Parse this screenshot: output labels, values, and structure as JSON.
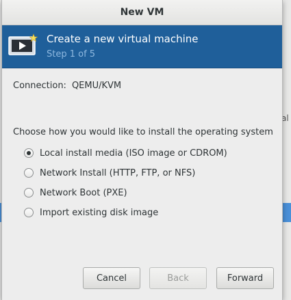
{
  "dialog": {
    "title": "New VM",
    "banner_title": "Create a new virtual machine",
    "banner_step": "Step 1 of 5",
    "connection_label": "Connection:",
    "connection_value": "QEMU/KVM",
    "install_prompt": "Choose how you would like to install the operating system",
    "options": [
      {
        "label": "Local install media (ISO image or CDROM)",
        "selected": true
      },
      {
        "label": "Network Install (HTTP, FTP, or NFS)",
        "selected": false
      },
      {
        "label": "Network Boot (PXE)",
        "selected": false
      },
      {
        "label": "Import existing disk image",
        "selected": false
      }
    ],
    "buttons": {
      "cancel": "Cancel",
      "back": "Back",
      "forward": "Forward"
    }
  },
  "background_window": {
    "edge_text": "al"
  },
  "colors": {
    "banner": "#1f5f9a",
    "banner_step": "#8fb9e0",
    "accent": "#4a90d9"
  }
}
